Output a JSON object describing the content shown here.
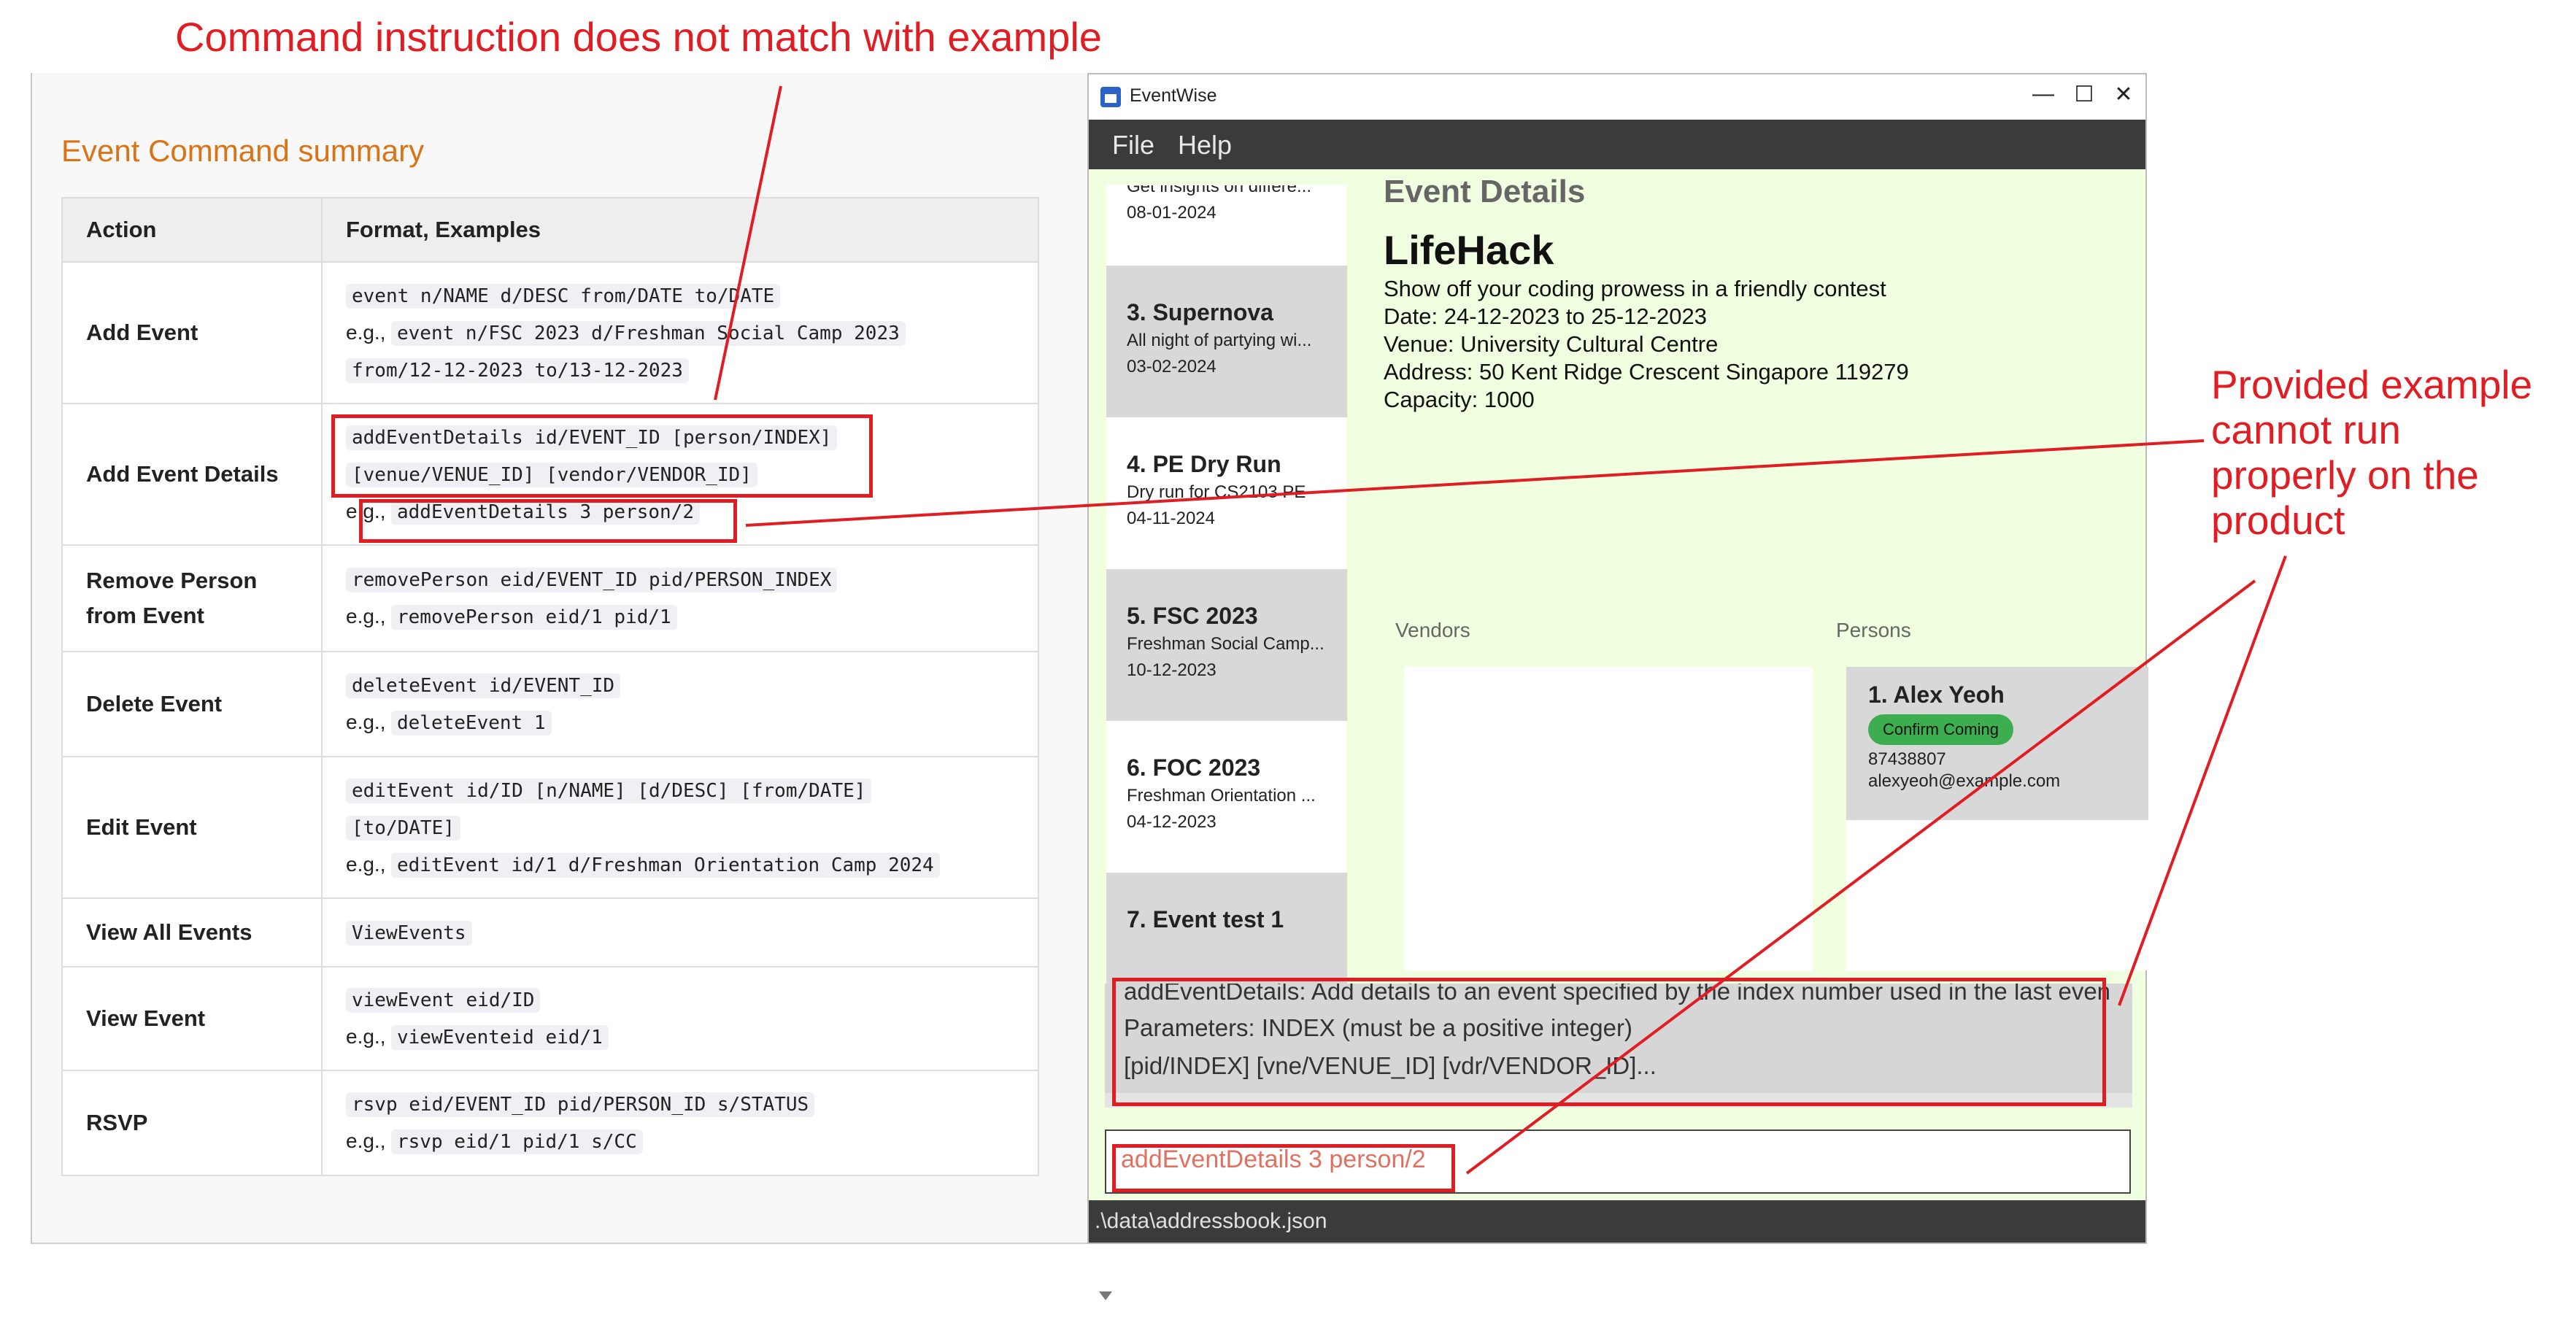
{
  "doc": {
    "title": "Event Command summary",
    "table": {
      "headers": [
        "Action",
        "Format, Examples"
      ],
      "rows": [
        {
          "action": "Add Event",
          "lines": [
            "event n/NAME d/DESC from/DATE to/DATE",
            "event n/FSC 2023 d/Freshman Social Camp 2023",
            "from/12-12-2023 to/13-12-2023"
          ]
        },
        {
          "action": "Add Event Details",
          "lines": [
            "addEventDetails id/EVENT_ID [person/INDEX]",
            "[venue/VENUE_ID] [vendor/VENDOR_ID]",
            "addEventDetails 3 person/2"
          ]
        },
        {
          "action": "Remove Person from Event",
          "lines": [
            "removePerson eid/EVENT_ID pid/PERSON_INDEX",
            "removePerson eid/1 pid/1"
          ]
        },
        {
          "action": "Delete Event",
          "lines": [
            "deleteEvent id/EVENT_ID",
            "deleteEvent 1"
          ]
        },
        {
          "action": "Edit Event",
          "lines": [
            "editEvent id/ID [n/NAME] [d/DESC] [from/DATE]",
            "[to/DATE]",
            "editEvent id/1 d/Freshman Orientation Camp 2024"
          ]
        },
        {
          "action": "View All Events",
          "lines": [
            "ViewEvents"
          ]
        },
        {
          "action": "View Event",
          "lines": [
            "viewEvent eid/ID",
            "viewEventeid eid/1"
          ]
        },
        {
          "action": "RSVP",
          "lines": [
            "rsvp eid/EVENT_ID pid/PERSON_ID s/STATUS",
            "rsvp eid/1 pid/1 s/CC"
          ]
        }
      ],
      "eg_prefix": "e.g.,"
    }
  },
  "app": {
    "title": "EventWise",
    "window_controls": [
      "—",
      "☐",
      "✕"
    ],
    "menu": [
      "File",
      "Help"
    ],
    "events": [
      {
        "title": "",
        "desc": "Get insights on differe...",
        "date": "08-01-2024"
      },
      {
        "title": "3.  Supernova",
        "desc": "All night of partying wi...",
        "date": "03-02-2024"
      },
      {
        "title": "4.  PE Dry Run",
        "desc": "Dry run for CS2103 PE",
        "date": "04-11-2024"
      },
      {
        "title": "5.  FSC 2023",
        "desc": "Freshman Social Camp...",
        "date": "10-12-2023"
      },
      {
        "title": "6.  FOC 2023",
        "desc": "Freshman Orientation ...",
        "date": "04-12-2023"
      },
      {
        "title": "7.  Event test 1",
        "desc": "",
        "date": ""
      }
    ],
    "details": {
      "heading": "Event Details",
      "name": "LifeHack",
      "description": "Show off your coding prowess in a friendly contest",
      "date": "Date: 24-12-2023 to 25-12-2023",
      "venue": "Venue: University Cultural Centre",
      "address": "Address: 50 Kent Ridge Crescent Singapore 119279",
      "capacity": "Capacity: 1000",
      "vendors_label": "Vendors",
      "persons_label": "Persons",
      "person": {
        "name": "1.  Alex Yeoh",
        "tag": "Confirm Coming",
        "phone": "87438807",
        "email": "alexyeoh@example.com"
      }
    },
    "result_lines": [
      "addEventDetails: Add details to an event specified by the index number used in the last even",
      "Parameters: INDEX (must be a positive integer)",
      "[pid/INDEX] [vne/VENUE_ID] [vdr/VENDOR_ID]..."
    ],
    "command_input": "addEventDetails 3 person/2",
    "status": ".\\data\\addressbook.json"
  },
  "annotations": {
    "top": "Command instruction does not match with example",
    "right": [
      "Provided example",
      "cannot run",
      "properly on the",
      "product"
    ],
    "color": "#e11d24"
  }
}
